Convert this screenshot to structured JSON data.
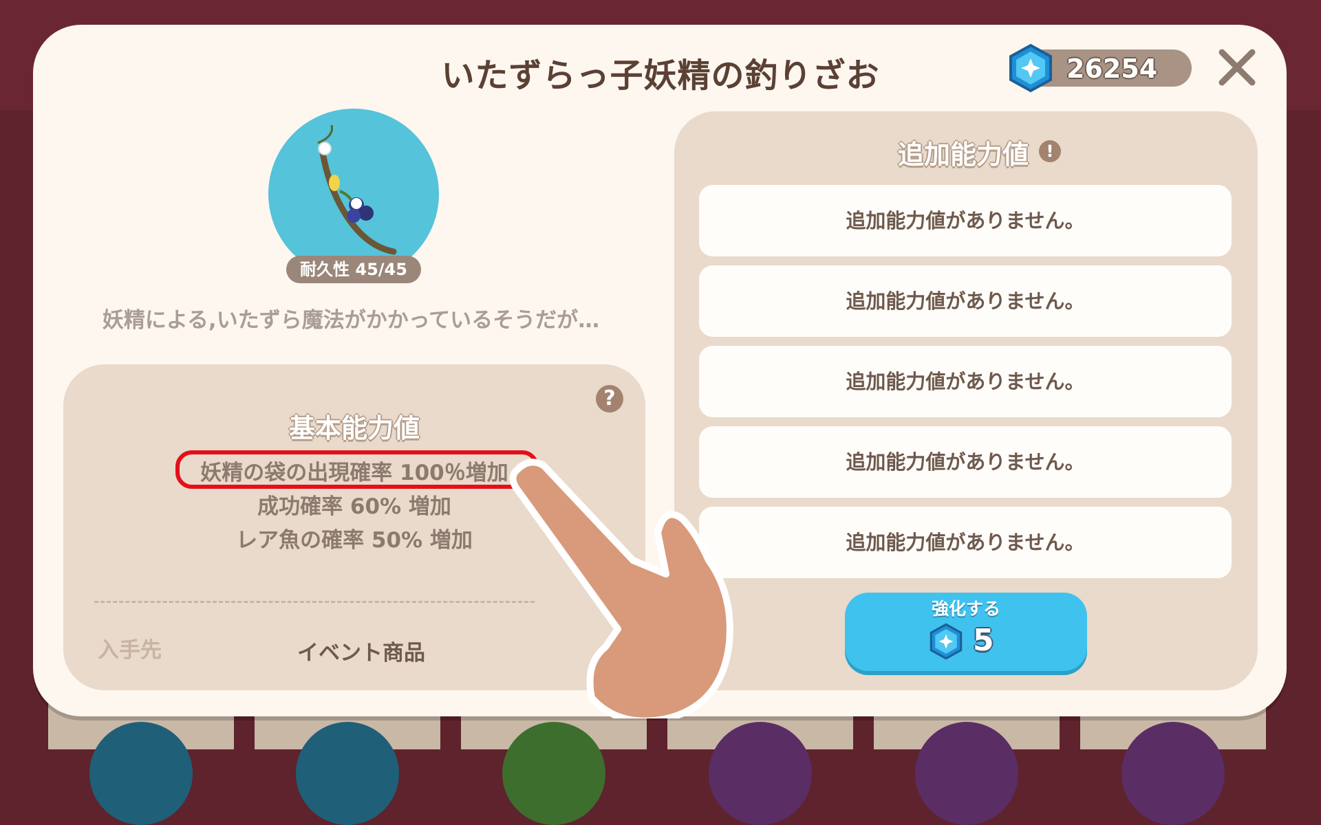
{
  "dialog": {
    "title": "いたずらっ子妖精の釣りざお",
    "currency": {
      "amount": "26254",
      "icon": "blue-gem-icon"
    },
    "close_icon": "close-icon"
  },
  "item": {
    "durability": "耐久性 45/45",
    "description": "妖精による,いたずら魔法がかかっているそうだが…",
    "image": "fairy-fishing-rod-image"
  },
  "base_stats": {
    "title": "基本能力値",
    "help_icon": "question-icon",
    "stats": [
      "妖精の袋の出現確率 100％増加",
      "成功確率 60% 増加",
      "レア魚の確率 50% 増加"
    ],
    "source_label": "入手先",
    "source_value": "イベント商品"
  },
  "extra_stats": {
    "title": "追加能力値",
    "info_icon": "exclamation-icon",
    "slots": [
      "追加能力値がありません。",
      "追加能力値がありません。",
      "追加能力値がありません。",
      "追加能力値がありません。",
      "追加能力値がありません。"
    ]
  },
  "upgrade_button": {
    "label": "強化する",
    "cost": "5",
    "icon": "blue-gem-icon"
  },
  "colors": {
    "modal_bg": "#fdf7f0",
    "panel_bg": "#e9dacb",
    "accent_blue": "#3fc2ee",
    "highlight_red": "#e3101a",
    "backdrop": "#5e232d"
  }
}
